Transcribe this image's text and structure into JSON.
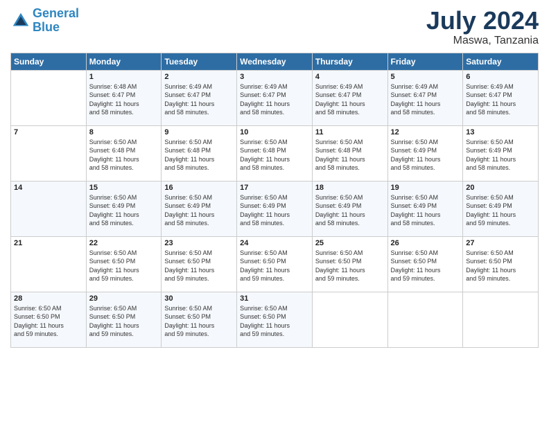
{
  "header": {
    "logo_line1": "General",
    "logo_line2": "Blue",
    "month_title": "July 2024",
    "location": "Maswa, Tanzania"
  },
  "days_of_week": [
    "Sunday",
    "Monday",
    "Tuesday",
    "Wednesday",
    "Thursday",
    "Friday",
    "Saturday"
  ],
  "weeks": [
    [
      {
        "day": "",
        "info": ""
      },
      {
        "day": "1",
        "info": "Sunrise: 6:48 AM\nSunset: 6:47 PM\nDaylight: 11 hours\nand 58 minutes."
      },
      {
        "day": "2",
        "info": "Sunrise: 6:49 AM\nSunset: 6:47 PM\nDaylight: 11 hours\nand 58 minutes."
      },
      {
        "day": "3",
        "info": "Sunrise: 6:49 AM\nSunset: 6:47 PM\nDaylight: 11 hours\nand 58 minutes."
      },
      {
        "day": "4",
        "info": "Sunrise: 6:49 AM\nSunset: 6:47 PM\nDaylight: 11 hours\nand 58 minutes."
      },
      {
        "day": "5",
        "info": "Sunrise: 6:49 AM\nSunset: 6:47 PM\nDaylight: 11 hours\nand 58 minutes."
      },
      {
        "day": "6",
        "info": "Sunrise: 6:49 AM\nSunset: 6:47 PM\nDaylight: 11 hours\nand 58 minutes."
      }
    ],
    [
      {
        "day": "7",
        "info": ""
      },
      {
        "day": "8",
        "info": "Sunrise: 6:50 AM\nSunset: 6:48 PM\nDaylight: 11 hours\nand 58 minutes."
      },
      {
        "day": "9",
        "info": "Sunrise: 6:50 AM\nSunset: 6:48 PM\nDaylight: 11 hours\nand 58 minutes."
      },
      {
        "day": "10",
        "info": "Sunrise: 6:50 AM\nSunset: 6:48 PM\nDaylight: 11 hours\nand 58 minutes."
      },
      {
        "day": "11",
        "info": "Sunrise: 6:50 AM\nSunset: 6:48 PM\nDaylight: 11 hours\nand 58 minutes."
      },
      {
        "day": "12",
        "info": "Sunrise: 6:50 AM\nSunset: 6:49 PM\nDaylight: 11 hours\nand 58 minutes."
      },
      {
        "day": "13",
        "info": "Sunrise: 6:50 AM\nSunset: 6:49 PM\nDaylight: 11 hours\nand 58 minutes."
      }
    ],
    [
      {
        "day": "14",
        "info": ""
      },
      {
        "day": "15",
        "info": "Sunrise: 6:50 AM\nSunset: 6:49 PM\nDaylight: 11 hours\nand 58 minutes."
      },
      {
        "day": "16",
        "info": "Sunrise: 6:50 AM\nSunset: 6:49 PM\nDaylight: 11 hours\nand 58 minutes."
      },
      {
        "day": "17",
        "info": "Sunrise: 6:50 AM\nSunset: 6:49 PM\nDaylight: 11 hours\nand 58 minutes."
      },
      {
        "day": "18",
        "info": "Sunrise: 6:50 AM\nSunset: 6:49 PM\nDaylight: 11 hours\nand 58 minutes."
      },
      {
        "day": "19",
        "info": "Sunrise: 6:50 AM\nSunset: 6:49 PM\nDaylight: 11 hours\nand 58 minutes."
      },
      {
        "day": "20",
        "info": "Sunrise: 6:50 AM\nSunset: 6:49 PM\nDaylight: 11 hours\nand 59 minutes."
      }
    ],
    [
      {
        "day": "21",
        "info": ""
      },
      {
        "day": "22",
        "info": "Sunrise: 6:50 AM\nSunset: 6:50 PM\nDaylight: 11 hours\nand 59 minutes."
      },
      {
        "day": "23",
        "info": "Sunrise: 6:50 AM\nSunset: 6:50 PM\nDaylight: 11 hours\nand 59 minutes."
      },
      {
        "day": "24",
        "info": "Sunrise: 6:50 AM\nSunset: 6:50 PM\nDaylight: 11 hours\nand 59 minutes."
      },
      {
        "day": "25",
        "info": "Sunrise: 6:50 AM\nSunset: 6:50 PM\nDaylight: 11 hours\nand 59 minutes."
      },
      {
        "day": "26",
        "info": "Sunrise: 6:50 AM\nSunset: 6:50 PM\nDaylight: 11 hours\nand 59 minutes."
      },
      {
        "day": "27",
        "info": "Sunrise: 6:50 AM\nSunset: 6:50 PM\nDaylight: 11 hours\nand 59 minutes."
      }
    ],
    [
      {
        "day": "28",
        "info": "Sunrise: 6:50 AM\nSunset: 6:50 PM\nDaylight: 11 hours\nand 59 minutes."
      },
      {
        "day": "29",
        "info": "Sunrise: 6:50 AM\nSunset: 6:50 PM\nDaylight: 11 hours\nand 59 minutes."
      },
      {
        "day": "30",
        "info": "Sunrise: 6:50 AM\nSunset: 6:50 PM\nDaylight: 11 hours\nand 59 minutes."
      },
      {
        "day": "31",
        "info": "Sunrise: 6:50 AM\nSunset: 6:50 PM\nDaylight: 11 hours\nand 59 minutes."
      },
      {
        "day": "",
        "info": ""
      },
      {
        "day": "",
        "info": ""
      },
      {
        "day": "",
        "info": ""
      }
    ]
  ]
}
